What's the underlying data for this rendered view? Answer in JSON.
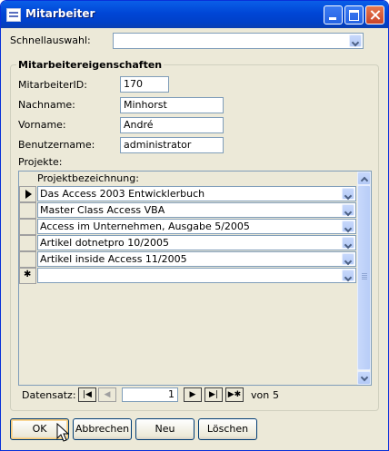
{
  "window": {
    "title": "Mitarbeiter"
  },
  "quick_select": {
    "label": "Schnellauswahl:",
    "value": ""
  },
  "group": {
    "title": "Mitarbeitereigenschaften"
  },
  "fields": [
    {
      "label": "MitarbeiterID:",
      "value": "170"
    },
    {
      "label": "Nachname:",
      "value": "Minhorst"
    },
    {
      "label": "Vorname:",
      "value": "André"
    },
    {
      "label": "Benutzername:",
      "value": "administrator"
    }
  ],
  "projects": {
    "label": "Projekte:",
    "column_header": "Projektbezeichnung:",
    "rows": [
      "Das Access 2003 Entwicklerbuch",
      "Master Class Access VBA",
      "Access im Unternehmen, Ausgabe 5/2005",
      "Artikel dotnetpro 10/2005",
      "Artikel inside Access 11/2005"
    ],
    "new_row_value": "",
    "navigation": {
      "label": "Datensatz:",
      "current": "1",
      "of_label": "von",
      "total": "5"
    }
  },
  "buttons": {
    "ok": "OK",
    "cancel": "Abbrechen",
    "new": "Neu",
    "delete": "Löschen"
  },
  "colors": {
    "titlebar": "#0046d6",
    "window_bg": "#ece9d8",
    "group_title": "#000000"
  }
}
